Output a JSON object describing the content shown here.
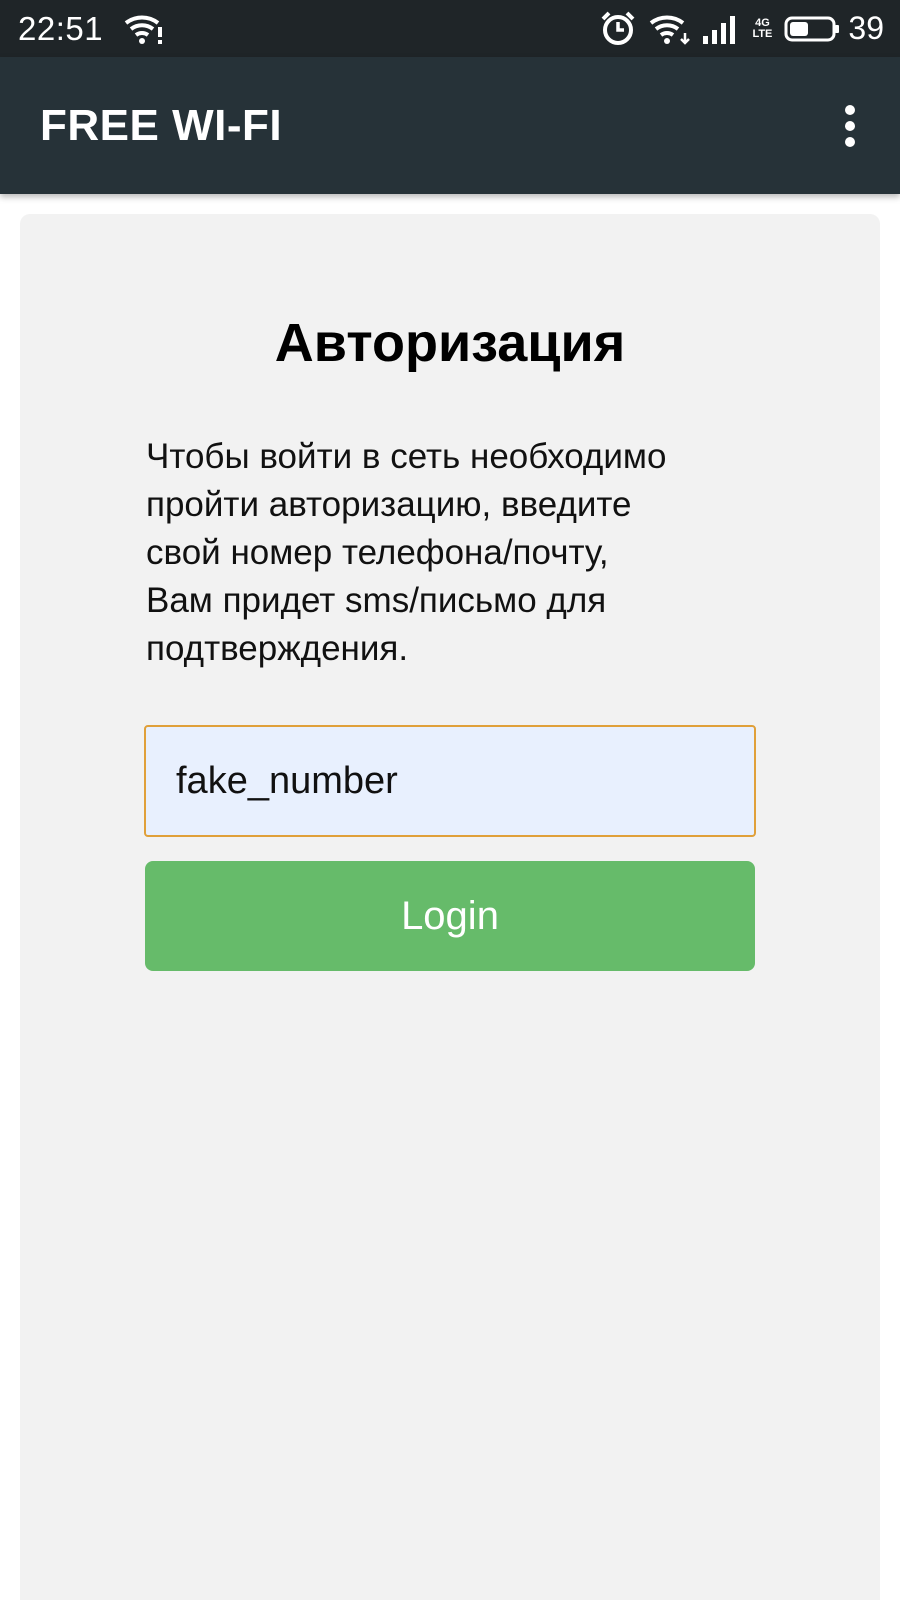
{
  "status_bar": {
    "time": "22:51",
    "network_badge_top": "4G",
    "network_badge_bottom": "LTE",
    "battery_level": "39",
    "icons": [
      "wifi-alert-icon",
      "alarm-icon",
      "wifi-icon",
      "cell-signal-icon",
      "battery-icon"
    ]
  },
  "app_bar": {
    "title": "FREE WI-FI",
    "menu_icon": "more-vert-icon"
  },
  "auth": {
    "title": "Авторизация",
    "description": "Чтобы войти в сеть необходимо\nпройти авторизацию, введите\nсвой номер телефона/почту,\nВам придет sms/письмо для\nподтверждения.",
    "input_value": "fake_number",
    "login_label": "Login"
  },
  "colors": {
    "status_bar": "#1f2528",
    "app_bar": "#263238",
    "card": "#f2f2f2",
    "input_bg": "#e8f0fe",
    "input_border": "#e0a03a",
    "login_button": "#66bb6a"
  }
}
